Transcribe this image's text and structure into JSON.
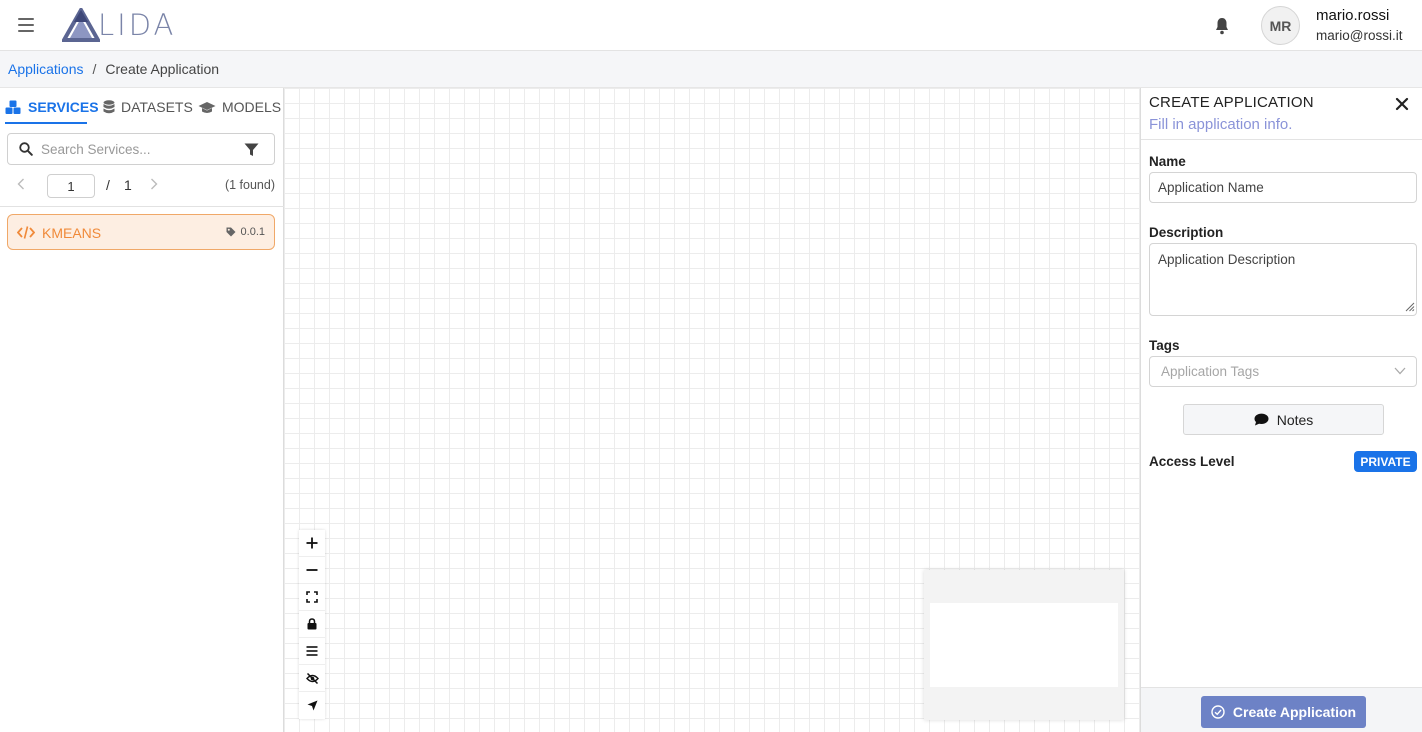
{
  "header": {
    "logo_text": "LIDA",
    "user": {
      "initials": "MR",
      "name": "mario.rossi",
      "email": "mario@rossi.it"
    }
  },
  "breadcrumb": {
    "parent": "Applications",
    "separator": "/",
    "current": "Create Application"
  },
  "left_panel": {
    "tabs": [
      {
        "label": "SERVICES",
        "icon": "cubes-icon",
        "active": true
      },
      {
        "label": "DATASETS",
        "icon": "database-icon",
        "active": false
      },
      {
        "label": "MODELS",
        "icon": "graduation-cap-icon",
        "active": false
      }
    ],
    "search": {
      "placeholder": "Search Services..."
    },
    "pagination": {
      "current_page": "1",
      "separator": "/",
      "total_pages": "1",
      "found_text": "(1 found)"
    },
    "services": [
      {
        "name": "KMEANS",
        "version": "0.0.1",
        "icon": "code-icon"
      }
    ]
  },
  "canvas": {
    "controls": [
      "zoom-in-icon",
      "zoom-out-icon",
      "fit-view-icon",
      "lock-icon",
      "menu-icon",
      "hide-icon",
      "navigate-icon"
    ]
  },
  "right_panel": {
    "title": "CREATE APPLICATION",
    "subtitle": "Fill in application info.",
    "name_label": "Name",
    "name_placeholder": "Application Name",
    "description_label": "Description",
    "description_placeholder": "Application Description",
    "tags_label": "Tags",
    "tags_placeholder": "Application Tags",
    "notes_button": "Notes",
    "access_label": "Access Level",
    "access_value": "PRIVATE",
    "create_button": "Create Application"
  },
  "colors": {
    "accent": "#1a73e8",
    "service_bg": "#fdeee2",
    "service_border": "#f0a868",
    "service_text": "#f08a3a",
    "create_button": "#6d82c6",
    "subtitle": "#8a93d8"
  }
}
